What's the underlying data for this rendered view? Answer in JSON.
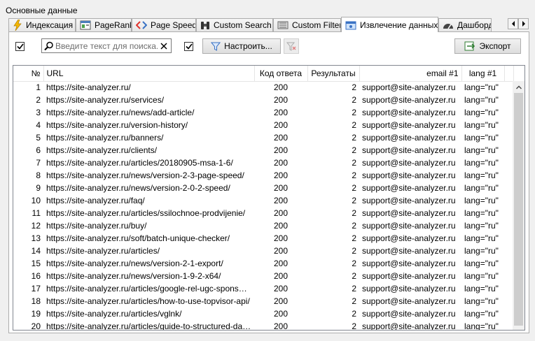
{
  "group_label": "Основные данные",
  "tabs": [
    {
      "label": "Индексация",
      "icon": "lightning-icon"
    },
    {
      "label": "PageRank",
      "icon": "pagerank-icon"
    },
    {
      "label": "Page Speed",
      "icon": "code-icon"
    },
    {
      "label": "Custom Search",
      "icon": "binoculars-icon"
    },
    {
      "label": "Custom Filters",
      "icon": "filter-grid-icon"
    },
    {
      "label": "Извлечение данных",
      "icon": "extract-data-icon",
      "active": true
    },
    {
      "label": "Дашборд",
      "icon": "dashboard-icon"
    }
  ],
  "toolbar": {
    "search_placeholder": "Введите текст для поиска...",
    "configure_label": "Настроить...",
    "export_label": "Экспорт"
  },
  "table": {
    "columns": [
      "№",
      "URL",
      "Код ответа",
      "Результаты",
      "email #1",
      "lang #1"
    ],
    "rows": [
      [
        "1",
        "https://site-analyzer.ru/",
        "200",
        "2",
        "support@site-analyzer.ru",
        "lang=\"ru\""
      ],
      [
        "2",
        "https://site-analyzer.ru/services/",
        "200",
        "2",
        "support@site-analyzer.ru",
        "lang=\"ru\""
      ],
      [
        "3",
        "https://site-analyzer.ru/news/add-article/",
        "200",
        "2",
        "support@site-analyzer.ru",
        "lang=\"ru\""
      ],
      [
        "4",
        "https://site-analyzer.ru/version-history/",
        "200",
        "2",
        "support@site-analyzer.ru",
        "lang=\"ru\""
      ],
      [
        "5",
        "https://site-analyzer.ru/banners/",
        "200",
        "2",
        "support@site-analyzer.ru",
        "lang=\"ru\""
      ],
      [
        "6",
        "https://site-analyzer.ru/clients/",
        "200",
        "2",
        "support@site-analyzer.ru",
        "lang=\"ru\""
      ],
      [
        "7",
        "https://site-analyzer.ru/articles/20180905-msa-1-6/",
        "200",
        "2",
        "support@site-analyzer.ru",
        "lang=\"ru\""
      ],
      [
        "8",
        "https://site-analyzer.ru/news/version-2-3-page-speed/",
        "200",
        "2",
        "support@site-analyzer.ru",
        "lang=\"ru\""
      ],
      [
        "9",
        "https://site-analyzer.ru/news/version-2-0-2-speed/",
        "200",
        "2",
        "support@site-analyzer.ru",
        "lang=\"ru\""
      ],
      [
        "10",
        "https://site-analyzer.ru/faq/",
        "200",
        "2",
        "support@site-analyzer.ru",
        "lang=\"ru\""
      ],
      [
        "11",
        "https://site-analyzer.ru/articles/ssilochnoe-prodvijenie/",
        "200",
        "2",
        "support@site-analyzer.ru",
        "lang=\"ru\""
      ],
      [
        "12",
        "https://site-analyzer.ru/buy/",
        "200",
        "2",
        "support@site-analyzer.ru",
        "lang=\"ru\""
      ],
      [
        "13",
        "https://site-analyzer.ru/soft/batch-unique-checker/",
        "200",
        "2",
        "support@site-analyzer.ru",
        "lang=\"ru\""
      ],
      [
        "14",
        "https://site-analyzer.ru/articles/",
        "200",
        "2",
        "support@site-analyzer.ru",
        "lang=\"ru\""
      ],
      [
        "15",
        "https://site-analyzer.ru/news/version-2-1-export/",
        "200",
        "2",
        "support@site-analyzer.ru",
        "lang=\"ru\""
      ],
      [
        "16",
        "https://site-analyzer.ru/news/version-1-9-2-x64/",
        "200",
        "2",
        "support@site-analyzer.ru",
        "lang=\"ru\""
      ],
      [
        "17",
        "https://site-analyzer.ru/articles/google-rel-ugc-sponsored/",
        "200",
        "2",
        "support@site-analyzer.ru",
        "lang=\"ru\""
      ],
      [
        "18",
        "https://site-analyzer.ru/articles/how-to-use-topvisor-api/",
        "200",
        "2",
        "support@site-analyzer.ru",
        "lang=\"ru\""
      ],
      [
        "19",
        "https://site-analyzer.ru/articles/vglnk/",
        "200",
        "2",
        "support@site-analyzer.ru",
        "lang=\"ru\""
      ],
      [
        "20",
        "https://site-analyzer.ru/articles/guide-to-structured-dat...",
        "200",
        "2",
        "support@site-analyzer.ru",
        "lang=\"ru\""
      ]
    ]
  }
}
